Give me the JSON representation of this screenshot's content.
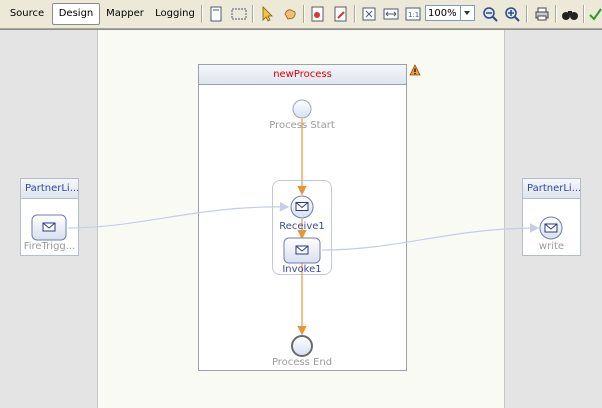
{
  "tabs": [
    {
      "label": "Source",
      "active": false
    },
    {
      "label": "Design",
      "active": true
    },
    {
      "label": "Mapper",
      "active": false
    },
    {
      "label": "Logging",
      "active": false
    }
  ],
  "toolbar": {
    "zoom_value": "100%"
  },
  "process": {
    "title": "newProcess",
    "start_label": "Process Start",
    "end_label": "Process End",
    "receive_label": "Receive1",
    "invoke_label": "Invoke1"
  },
  "partner_left": {
    "title": "PartnerLi...",
    "operation_label": "FireTrigg..."
  },
  "partner_right": {
    "title": "PartnerLi...",
    "operation_label": "write"
  },
  "colors": {
    "flow_line": "#e8953a",
    "link_line": "#c6cde8",
    "title_red": "#e00000",
    "partner_blue": "#2b4aa3"
  }
}
